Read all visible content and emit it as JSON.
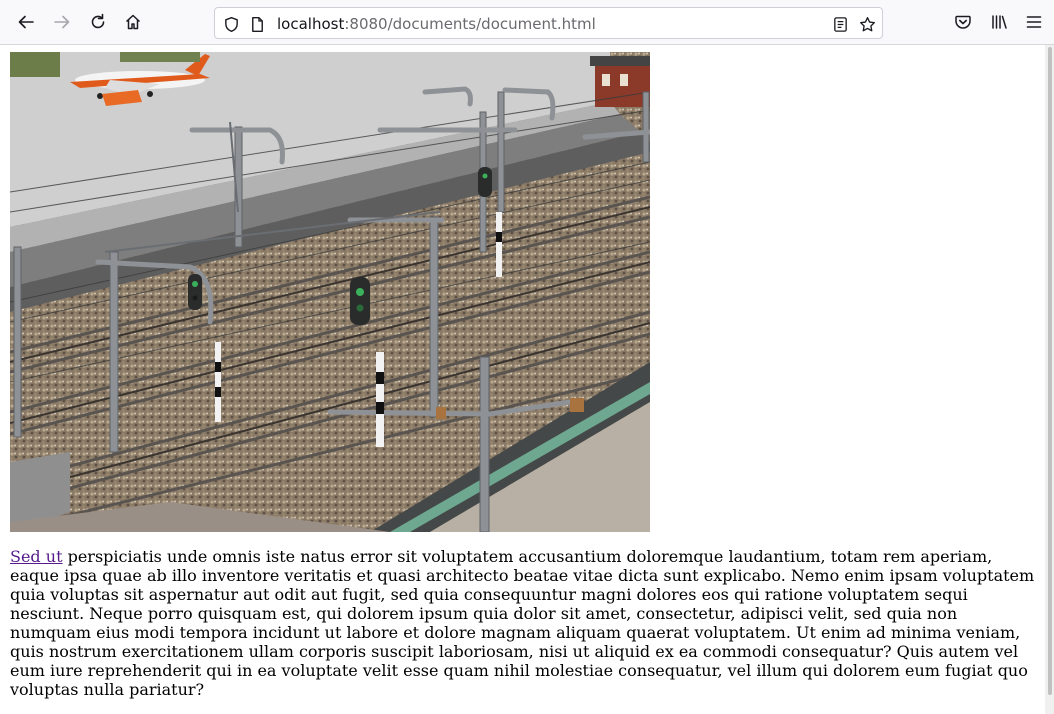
{
  "browser": {
    "url_host": "localhost",
    "url_rest": ":8080/documents/document.html",
    "icons": [
      "back-arrow-icon",
      "forward-arrow-icon",
      "reload-icon",
      "home-icon",
      "shield-icon",
      "page-icon",
      "reader-view-icon",
      "bookmark-star-icon",
      "pocket-icon",
      "library-icon",
      "menu-icon"
    ]
  },
  "content": {
    "image_subject": "model railway tracks with overhead catenary masts and signals",
    "link_text": "Sed ut",
    "paragraph_text": " perspiciatis unde omnis iste natus error sit voluptatem accusantium doloremque laudantium, totam rem aperiam, eaque ipsa quae ab illo inventore veritatis et quasi architecto beatae vitae dicta sunt explicabo. Nemo enim ipsam voluptatem quia voluptas sit aspernatur aut odit aut fugit, sed quia consequuntur magni dolores eos qui ratione voluptatem sequi nesciunt. Neque porro quisquam est, qui dolorem ipsum quia dolor sit amet, consectetur, adipisci velit, sed quia non numquam eius modi tempora incidunt ut labore et dolore magnam aliquam quaerat voluptatem. Ut enim ad minima veniam, quis nostrum exercitationem ullam corporis suscipit laboriosam, nisi ut aliquid ex ea commodi consequatur? Quis autem vel eum iure reprehenderit qui in ea voluptate velit esse quam nihil molestiae consequatur, vel illum qui dolorem eum fugiat quo voluptas nulla pariatur?"
  },
  "colors": {
    "toolbar_bg": "#f9f9fb",
    "link_visited": "#551a8b"
  }
}
